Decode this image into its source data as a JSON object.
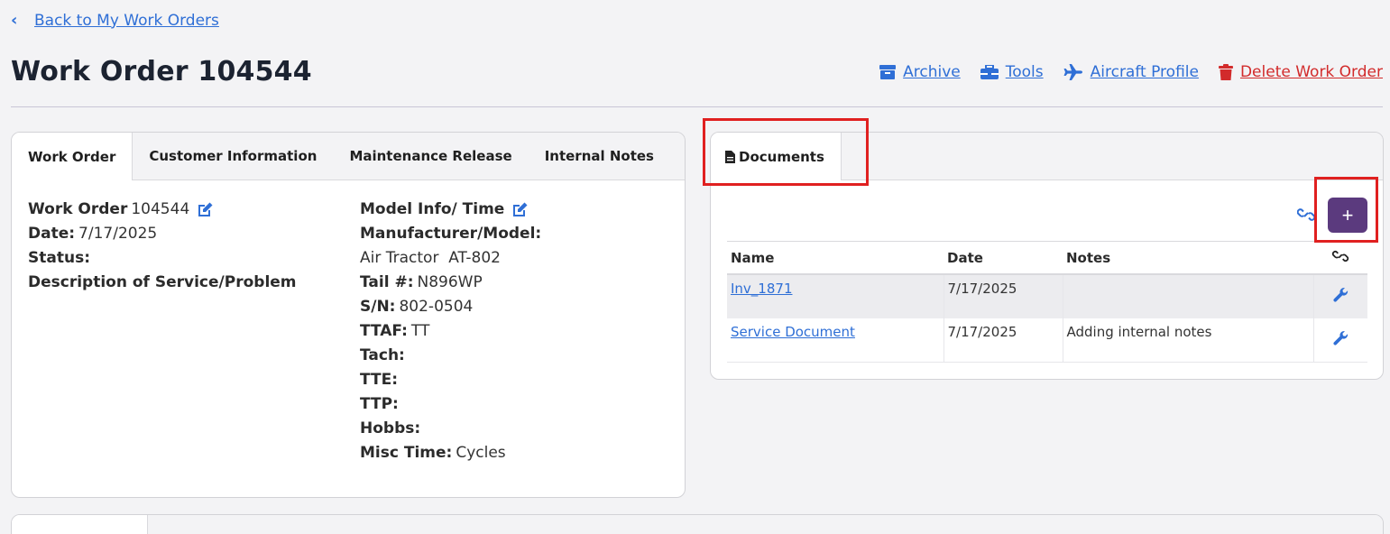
{
  "nav": {
    "back_label": "Back to My Work Orders"
  },
  "header": {
    "title": "Work Order 104544",
    "actions": [
      {
        "label": "Archive",
        "icon": "archive-icon"
      },
      {
        "label": "Tools",
        "icon": "toolbox-icon"
      },
      {
        "label": "Aircraft Profile",
        "icon": "plane-icon"
      },
      {
        "label": "Delete Work Order",
        "icon": "trash-icon"
      }
    ]
  },
  "left_panel": {
    "tabs": [
      "Work Order",
      "Customer Information",
      "Maintenance Release",
      "Internal Notes"
    ],
    "col1": {
      "wo_label": "Work Order",
      "wo_value": "104544",
      "date_label": "Date:",
      "date_value": "7/17/2025",
      "status_label": "Status:",
      "desc_label": "Description of Service/Problem"
    },
    "col2": {
      "model_label": "Model Info/ Time",
      "manuf_label": "Manufacturer/Model:",
      "manuf_value": "Air Tractor  AT-802",
      "tail_label": "Tail #:",
      "tail_value": "N896WP",
      "sn_label": "S/N:",
      "sn_value": "802-0504",
      "ttaf_label": "TTAF:",
      "ttaf_value": "TT",
      "tach_label": "Tach:",
      "tte_label": "TTE:",
      "ttp_label": "TTP:",
      "hobbs_label": "Hobbs:",
      "misc_label": "Misc Time:",
      "misc_value": "Cycles"
    }
  },
  "documents_panel": {
    "tab_label": "Documents",
    "add_label": "+",
    "columns": [
      "Name",
      "Date",
      "Notes"
    ],
    "rows": [
      {
        "name": "Inv_1871",
        "date": "7/17/2025",
        "notes": ""
      },
      {
        "name": "Service Document",
        "date": "7/17/2025",
        "notes": "Adding internal notes"
      }
    ]
  },
  "colors": {
    "accent": "#2f6fd6",
    "danger": "#d22b2b",
    "add_button": "#5b3a7e",
    "highlight": "#e02020"
  }
}
